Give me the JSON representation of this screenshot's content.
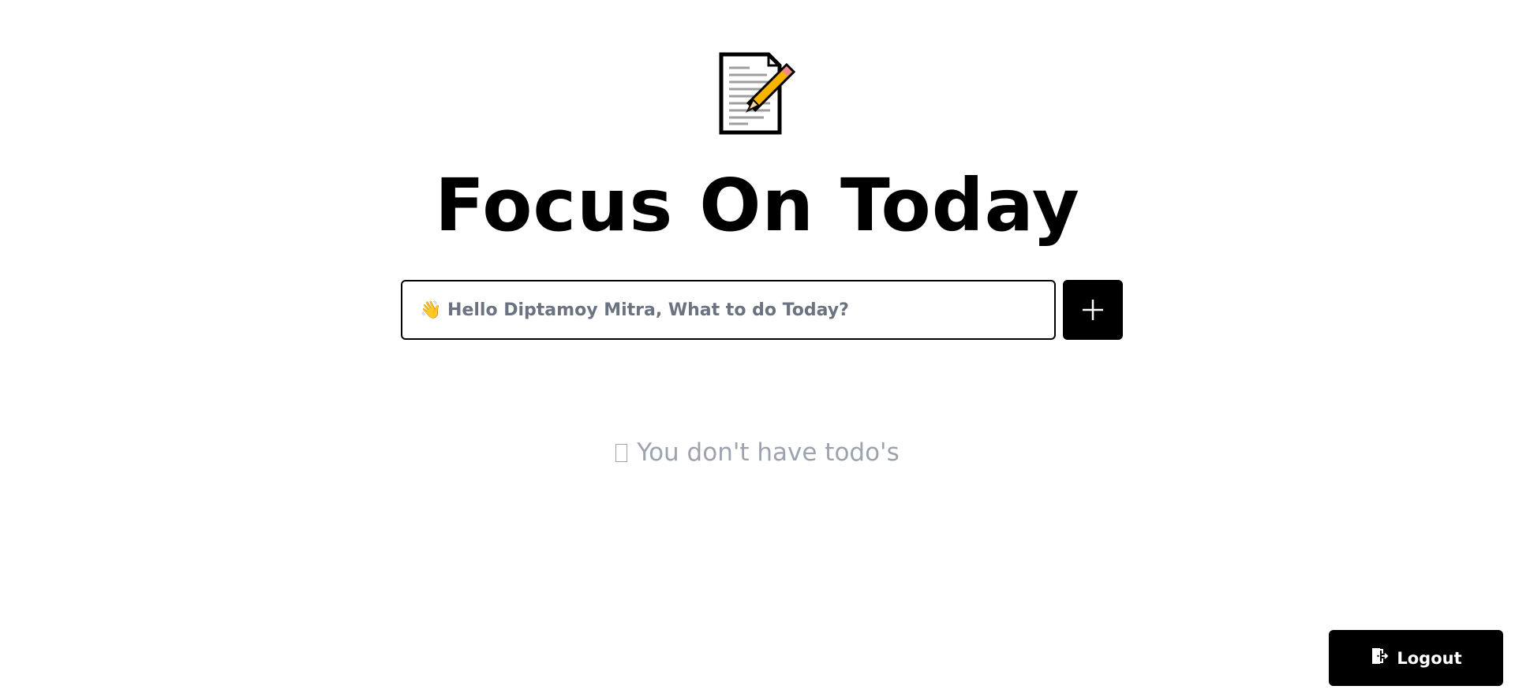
{
  "header": {
    "logo_icon": "memo-pencil-icon",
    "title": "Focus On Today"
  },
  "todo_form": {
    "placeholder": "👋 Hello Diptamoy Mitra, What to do Today?",
    "value": "",
    "add_icon": "plus-icon"
  },
  "todo_list": {
    "empty_icon": "missing-glyph-icon",
    "empty_message": "You don't have todo's"
  },
  "footer": {
    "logout_icon": "door-exit-icon",
    "logout_label": "Logout"
  },
  "colors": {
    "primary": "#000000",
    "background": "#ffffff",
    "placeholder": "#6b7280",
    "muted": "#9ca3af"
  }
}
